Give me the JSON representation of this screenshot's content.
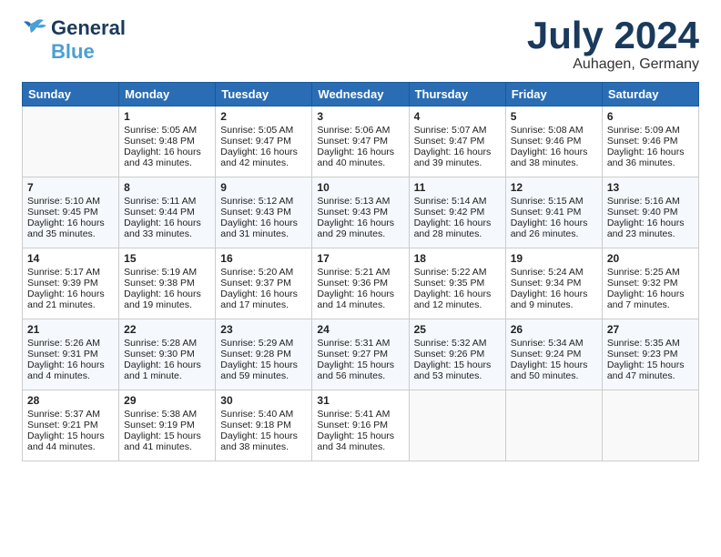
{
  "logo": {
    "line1": "General",
    "line2": "Blue"
  },
  "title": "July 2024",
  "location": "Auhagen, Germany",
  "headers": [
    "Sunday",
    "Monday",
    "Tuesday",
    "Wednesday",
    "Thursday",
    "Friday",
    "Saturday"
  ],
  "weeks": [
    [
      {
        "day": "",
        "sunrise": "",
        "sunset": "",
        "daylight": ""
      },
      {
        "day": "1",
        "sunrise": "Sunrise: 5:05 AM",
        "sunset": "Sunset: 9:48 PM",
        "daylight": "Daylight: 16 hours and 43 minutes."
      },
      {
        "day": "2",
        "sunrise": "Sunrise: 5:05 AM",
        "sunset": "Sunset: 9:47 PM",
        "daylight": "Daylight: 16 hours and 42 minutes."
      },
      {
        "day": "3",
        "sunrise": "Sunrise: 5:06 AM",
        "sunset": "Sunset: 9:47 PM",
        "daylight": "Daylight: 16 hours and 40 minutes."
      },
      {
        "day": "4",
        "sunrise": "Sunrise: 5:07 AM",
        "sunset": "Sunset: 9:47 PM",
        "daylight": "Daylight: 16 hours and 39 minutes."
      },
      {
        "day": "5",
        "sunrise": "Sunrise: 5:08 AM",
        "sunset": "Sunset: 9:46 PM",
        "daylight": "Daylight: 16 hours and 38 minutes."
      },
      {
        "day": "6",
        "sunrise": "Sunrise: 5:09 AM",
        "sunset": "Sunset: 9:46 PM",
        "daylight": "Daylight: 16 hours and 36 minutes."
      }
    ],
    [
      {
        "day": "7",
        "sunrise": "Sunrise: 5:10 AM",
        "sunset": "Sunset: 9:45 PM",
        "daylight": "Daylight: 16 hours and 35 minutes."
      },
      {
        "day": "8",
        "sunrise": "Sunrise: 5:11 AM",
        "sunset": "Sunset: 9:44 PM",
        "daylight": "Daylight: 16 hours and 33 minutes."
      },
      {
        "day": "9",
        "sunrise": "Sunrise: 5:12 AM",
        "sunset": "Sunset: 9:43 PM",
        "daylight": "Daylight: 16 hours and 31 minutes."
      },
      {
        "day": "10",
        "sunrise": "Sunrise: 5:13 AM",
        "sunset": "Sunset: 9:43 PM",
        "daylight": "Daylight: 16 hours and 29 minutes."
      },
      {
        "day": "11",
        "sunrise": "Sunrise: 5:14 AM",
        "sunset": "Sunset: 9:42 PM",
        "daylight": "Daylight: 16 hours and 28 minutes."
      },
      {
        "day": "12",
        "sunrise": "Sunrise: 5:15 AM",
        "sunset": "Sunset: 9:41 PM",
        "daylight": "Daylight: 16 hours and 26 minutes."
      },
      {
        "day": "13",
        "sunrise": "Sunrise: 5:16 AM",
        "sunset": "Sunset: 9:40 PM",
        "daylight": "Daylight: 16 hours and 23 minutes."
      }
    ],
    [
      {
        "day": "14",
        "sunrise": "Sunrise: 5:17 AM",
        "sunset": "Sunset: 9:39 PM",
        "daylight": "Daylight: 16 hours and 21 minutes."
      },
      {
        "day": "15",
        "sunrise": "Sunrise: 5:19 AM",
        "sunset": "Sunset: 9:38 PM",
        "daylight": "Daylight: 16 hours and 19 minutes."
      },
      {
        "day": "16",
        "sunrise": "Sunrise: 5:20 AM",
        "sunset": "Sunset: 9:37 PM",
        "daylight": "Daylight: 16 hours and 17 minutes."
      },
      {
        "day": "17",
        "sunrise": "Sunrise: 5:21 AM",
        "sunset": "Sunset: 9:36 PM",
        "daylight": "Daylight: 16 hours and 14 minutes."
      },
      {
        "day": "18",
        "sunrise": "Sunrise: 5:22 AM",
        "sunset": "Sunset: 9:35 PM",
        "daylight": "Daylight: 16 hours and 12 minutes."
      },
      {
        "day": "19",
        "sunrise": "Sunrise: 5:24 AM",
        "sunset": "Sunset: 9:34 PM",
        "daylight": "Daylight: 16 hours and 9 minutes."
      },
      {
        "day": "20",
        "sunrise": "Sunrise: 5:25 AM",
        "sunset": "Sunset: 9:32 PM",
        "daylight": "Daylight: 16 hours and 7 minutes."
      }
    ],
    [
      {
        "day": "21",
        "sunrise": "Sunrise: 5:26 AM",
        "sunset": "Sunset: 9:31 PM",
        "daylight": "Daylight: 16 hours and 4 minutes."
      },
      {
        "day": "22",
        "sunrise": "Sunrise: 5:28 AM",
        "sunset": "Sunset: 9:30 PM",
        "daylight": "Daylight: 16 hours and 1 minute."
      },
      {
        "day": "23",
        "sunrise": "Sunrise: 5:29 AM",
        "sunset": "Sunset: 9:28 PM",
        "daylight": "Daylight: 15 hours and 59 minutes."
      },
      {
        "day": "24",
        "sunrise": "Sunrise: 5:31 AM",
        "sunset": "Sunset: 9:27 PM",
        "daylight": "Daylight: 15 hours and 56 minutes."
      },
      {
        "day": "25",
        "sunrise": "Sunrise: 5:32 AM",
        "sunset": "Sunset: 9:26 PM",
        "daylight": "Daylight: 15 hours and 53 minutes."
      },
      {
        "day": "26",
        "sunrise": "Sunrise: 5:34 AM",
        "sunset": "Sunset: 9:24 PM",
        "daylight": "Daylight: 15 hours and 50 minutes."
      },
      {
        "day": "27",
        "sunrise": "Sunrise: 5:35 AM",
        "sunset": "Sunset: 9:23 PM",
        "daylight": "Daylight: 15 hours and 47 minutes."
      }
    ],
    [
      {
        "day": "28",
        "sunrise": "Sunrise: 5:37 AM",
        "sunset": "Sunset: 9:21 PM",
        "daylight": "Daylight: 15 hours and 44 minutes."
      },
      {
        "day": "29",
        "sunrise": "Sunrise: 5:38 AM",
        "sunset": "Sunset: 9:19 PM",
        "daylight": "Daylight: 15 hours and 41 minutes."
      },
      {
        "day": "30",
        "sunrise": "Sunrise: 5:40 AM",
        "sunset": "Sunset: 9:18 PM",
        "daylight": "Daylight: 15 hours and 38 minutes."
      },
      {
        "day": "31",
        "sunrise": "Sunrise: 5:41 AM",
        "sunset": "Sunset: 9:16 PM",
        "daylight": "Daylight: 15 hours and 34 minutes."
      },
      {
        "day": "",
        "sunrise": "",
        "sunset": "",
        "daylight": ""
      },
      {
        "day": "",
        "sunrise": "",
        "sunset": "",
        "daylight": ""
      },
      {
        "day": "",
        "sunrise": "",
        "sunset": "",
        "daylight": ""
      }
    ]
  ]
}
